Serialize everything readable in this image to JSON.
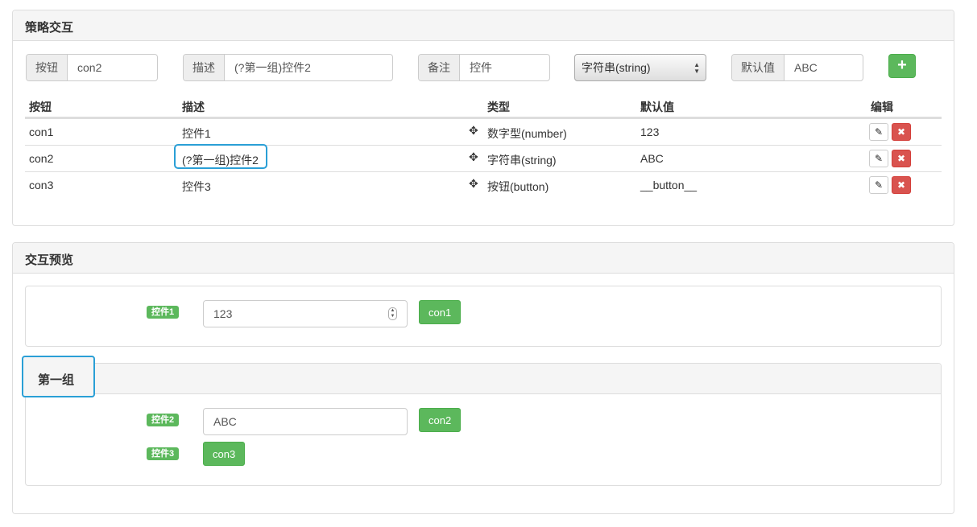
{
  "strategy_panel": {
    "title": "策略交互",
    "form": {
      "button_addon": "按钮",
      "button_value": "con2",
      "desc_addon": "描述",
      "desc_value": "(?第一组)控件2",
      "note_addon": "备注",
      "note_value": "控件",
      "type_select": "字符串(string)",
      "default_addon": "默认值",
      "default_value": "ABC",
      "add_label": "+"
    },
    "table": {
      "headers": [
        "按钮",
        "描述",
        "类型",
        "默认值",
        "编辑"
      ],
      "rows": [
        {
          "button": "con1",
          "desc": "控件1",
          "type": "数字型(number)",
          "default": "123"
        },
        {
          "button": "con2",
          "desc": "(?第一组)控件2",
          "type": "字符串(string)",
          "default": "ABC"
        },
        {
          "button": "con3",
          "desc": "控件3",
          "type": "按钮(button)",
          "default": "__button__"
        }
      ],
      "edit_glyph": "✎",
      "delete_glyph": "✖",
      "move_glyph": "✥"
    }
  },
  "preview_panel": {
    "title": "交互预览",
    "ungrouped": {
      "label": "控件1",
      "input_value": "123",
      "button": "con1"
    },
    "group": {
      "title": "第一组",
      "items": [
        {
          "label": "控件2",
          "input_value": "ABC",
          "button": "con2"
        },
        {
          "label": "控件3",
          "button": "con3"
        }
      ]
    }
  },
  "colors": {
    "primary_green": "#5cb85c",
    "danger_red": "#d9534f",
    "highlight_blue": "#2a9fd6"
  }
}
